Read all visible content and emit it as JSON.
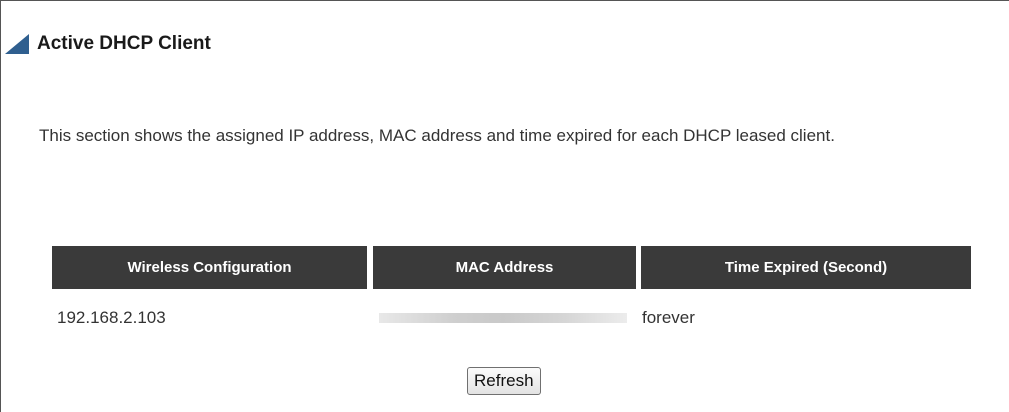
{
  "section": {
    "title": "Active DHCP Client",
    "description": "This section shows the assigned IP address, MAC address and time expired for each DHCP leased client."
  },
  "table": {
    "headers": [
      "Wireless Configuration",
      "MAC Address",
      "Time Expired (Second)"
    ],
    "rows": [
      {
        "ip": "192.168.2.103",
        "mac_redacted": true,
        "time_expired": "forever"
      }
    ]
  },
  "actions": {
    "refresh_label": "Refresh"
  },
  "colors": {
    "header_bg": "#3a3a3a",
    "title_marker": "#2f5f8f"
  }
}
